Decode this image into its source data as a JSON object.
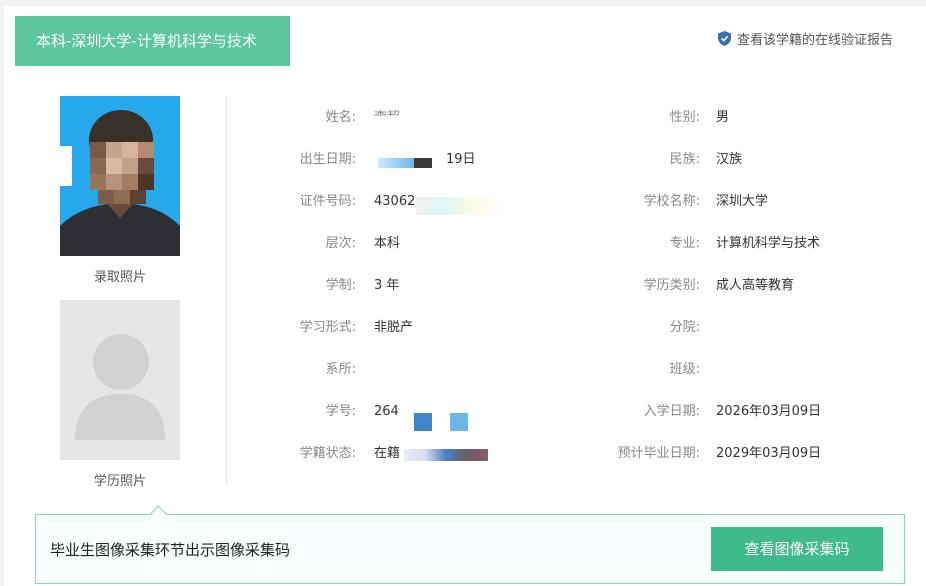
{
  "header": {
    "title": "本科-深圳大学-计算机科学与技术",
    "verify_link": "查看该学籍的在线验证报告"
  },
  "photos": {
    "admission_caption": "录取照片",
    "edu_caption": "学历照片"
  },
  "fields_left": [
    {
      "label": "姓名:",
      "value": "李超"
    },
    {
      "label": "出生日期:",
      "value": "19日"
    },
    {
      "label": "证件号码:",
      "value": "43062"
    },
    {
      "label": "层次:",
      "value": "本科"
    },
    {
      "label": "学制:",
      "value": "3 年"
    },
    {
      "label": "学习形式:",
      "value": "非脱产"
    },
    {
      "label": "系所:",
      "value": ""
    },
    {
      "label": "学号:",
      "value": "264"
    },
    {
      "label": "学籍状态:",
      "value": "在籍"
    }
  ],
  "fields_right": [
    {
      "label": "性别:",
      "value": "男"
    },
    {
      "label": "民族:",
      "value": "汉族"
    },
    {
      "label": "学校名称:",
      "value": "深圳大学"
    },
    {
      "label": "专业:",
      "value": "计算机科学与技术"
    },
    {
      "label": "学历类别:",
      "value": "成人高等教育"
    },
    {
      "label": "分院:",
      "value": ""
    },
    {
      "label": "班级:",
      "value": ""
    },
    {
      "label": "入学日期:",
      "value": "2026年03月09日"
    },
    {
      "label": "预计毕业日期:",
      "value": "2029年03月09日"
    }
  ],
  "panel": {
    "text": "毕业生图像采集环节出示图像采集码",
    "button": "查看图像采集码"
  },
  "colors": {
    "accent": "#5cc69f",
    "button": "#3fba8c"
  }
}
